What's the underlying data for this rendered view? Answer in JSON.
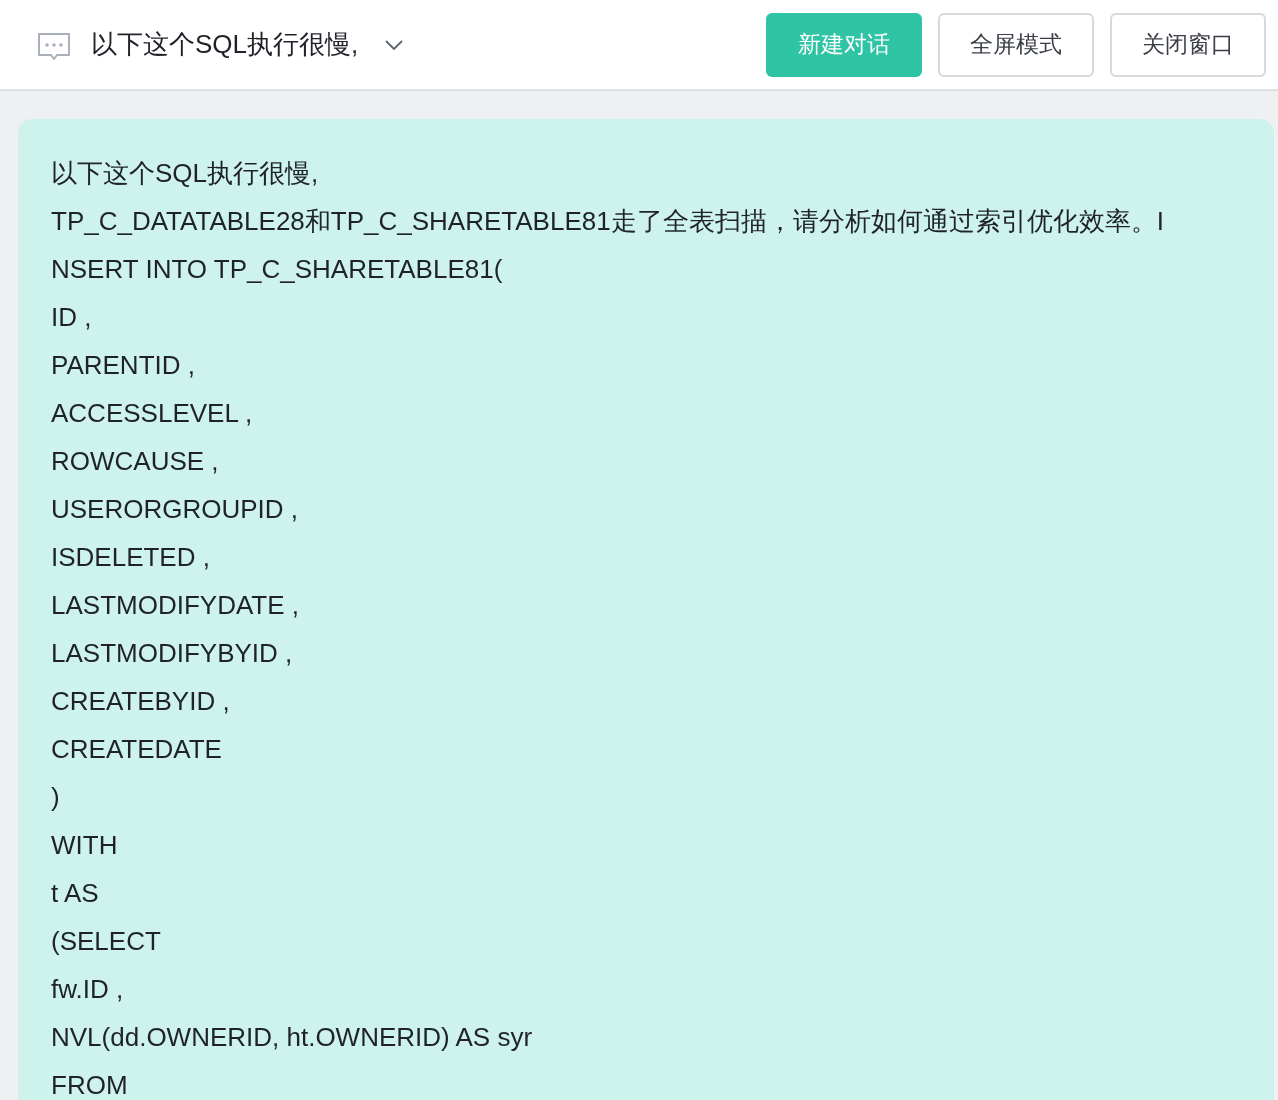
{
  "header": {
    "title": "以下这个SQL执行很慢,",
    "buttons": [
      {
        "label": "新建对话",
        "kind": "primary"
      },
      {
        "label": "全屏模式",
        "kind": "plain"
      },
      {
        "label": "关闭窗口",
        "kind": "plain"
      }
    ]
  },
  "message": {
    "lines": [
      "以下这个SQL执行很慢,",
      "TP_C_DATATABLE28和TP_C_SHARETABLE81走了全表扫描，请分析如何通过索引优化效率。I",
      "NSERT INTO TP_C_SHARETABLE81(",
      "ID ,",
      "PARENTID ,",
      "ACCESSLEVEL ,",
      "ROWCAUSE ,",
      "USERORGROUPID ,",
      "ISDELETED ,",
      "LASTMODIFYDATE ,",
      "LASTMODIFYBYID ,",
      "CREATEBYID ,",
      "CREATEDATE",
      ")",
      "WITH",
      "t AS",
      "(SELECT",
      "fw.ID ,",
      "NVL(dd.OWNERID, ht.OWNERID) AS syr",
      "FROM"
    ]
  }
}
